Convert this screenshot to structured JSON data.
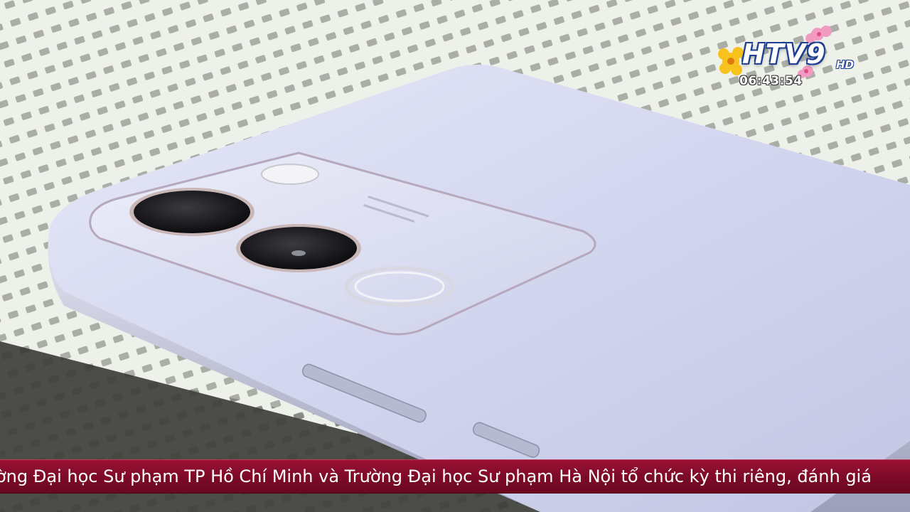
{
  "channel": {
    "logo_text": "HTV9",
    "logo_suffix": "HD",
    "clock": "06:43:54"
  },
  "ticker": {
    "text": "ờng Đại học Sư phạm TP Hồ Chí Minh và Trường Đại học Sư phạm Hà Nội tổ chức kỳ thi riêng, đánh giá"
  },
  "colors": {
    "ticker_background": "#7c0a27",
    "phone_body": "#d6d8f0",
    "logo_outline": "#1d3f93"
  }
}
